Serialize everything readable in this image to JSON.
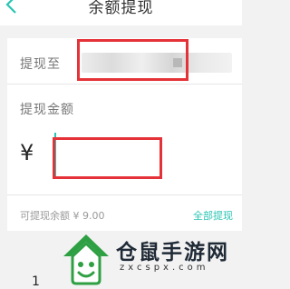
{
  "header": {
    "title": "余额提现",
    "back_icon": "chevron-left-icon"
  },
  "form": {
    "withdraw_to_label": "提现至",
    "amount_label": "提现金额",
    "currency_symbol": "¥",
    "available_balance": "可提现余额 ¥ 9.00",
    "withdraw_all_label": "全部提现"
  },
  "keypad": {
    "visible_key": "1"
  },
  "watermark": {
    "text": "仓鼠手游网",
    "url": "zxcspx.com"
  },
  "colors": {
    "accent": "#2bc4b3",
    "highlight_box": "#e53238",
    "background": "#f2f2f2"
  }
}
